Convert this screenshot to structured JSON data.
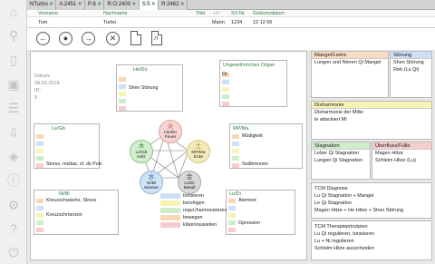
{
  "tabs": [
    {
      "label": "NTurbo",
      "active": false
    },
    {
      "label": "A:2451",
      "active": false
    },
    {
      "label": "P:6",
      "active": false
    },
    {
      "label": "R:O:2400",
      "active": false
    },
    {
      "label": "S:5",
      "active": true
    },
    {
      "label": "R:2462",
      "active": false
    }
  ],
  "tab_close": "×",
  "patient": {
    "headers": [
      "Vorname",
      "Nachname",
      "Titel",
      "♀/♂",
      "SV-Nr.",
      "Geburtsdatum"
    ],
    "row": [
      "Tom",
      "Turbo",
      "",
      "Mann",
      "1234",
      "12 12 66"
    ]
  },
  "info": {
    "datum_label": "Datum:",
    "datum": "28.03.2019",
    "id_label": "ID:",
    "id": "5"
  },
  "elements": {
    "fire": {
      "glyph": "火",
      "organs": "He/Dü",
      "name": "Feuer",
      "color": "#f5d5d5"
    },
    "earth": {
      "glyph": "土",
      "organs": "MP/Ma",
      "name": "Erde",
      "color": "#f3eabb"
    },
    "metal": {
      "glyph": "金",
      "organs": "Lu/Di",
      "name": "Metall",
      "color": "#d9d9d9"
    },
    "water": {
      "glyph": "水",
      "organs": "Ni/Bl",
      "name": "Wasser",
      "color": "#cfe3f5"
    },
    "wood": {
      "glyph": "木",
      "organs": "Le/Gb",
      "name": "Holz",
      "color": "#d3efcf"
    }
  },
  "organ_boxes": {
    "hedu": {
      "title": "He/Dü",
      "rows": [
        "",
        "Shen Störung",
        "",
        ""
      ]
    },
    "ungew": {
      "title": "Ungewöhnliches Organ",
      "rows": [
        "Or",
        "",
        "",
        ""
      ]
    },
    "legb": {
      "title": "Le/Gb",
      "rows": [
        "",
        "",
        "",
        "Stress, reizbar, sf, dü Puls"
      ]
    },
    "mpma": {
      "title": "MP/Ma",
      "rows": [
        "Müdigkeit",
        "",
        "",
        "Sodbrennen"
      ]
    },
    "nibl": {
      "title": "Ni/Bl",
      "rows": [
        "Kreuzschwäche, Stress",
        "",
        "Kreuzschmerzen",
        ""
      ]
    },
    "ludi": {
      "title": "Lu/Di",
      "rows": [
        "Atemnot",
        "",
        "",
        "Opression"
      ]
    }
  },
  "swatches": [
    "#f7d7b5",
    "#cde0f7",
    "#f7f3b5",
    "#cdeec9",
    "#f7cccc"
  ],
  "legend": [
    {
      "label": "tonisieren",
      "color": "#cde0f7"
    },
    {
      "label": "beruhigen",
      "color": "#f7f3b5"
    },
    {
      "label": "regul./harmonisieren",
      "color": "#cdeec9"
    },
    {
      "label": "bewegen",
      "color": "#f7d7b5"
    },
    {
      "label": "klären/ausleiten",
      "color": "#f7cccc"
    }
  ],
  "right": {
    "mangel": {
      "title": "Mangel/Leere",
      "text": "Lungen und Nieren Qi Mangel",
      "color": "#f8dcc0"
    },
    "stoerung": {
      "title": "Störung",
      "lines": [
        "Shen Störung",
        "Reb (Lu Qi)"
      ],
      "color": "#cde0f7"
    },
    "disharmonie": {
      "title": "Disharmonie",
      "lines": [
        "Disharmonie der Mitte",
        "le attackiert MI"
      ],
      "color": "#f7f3b5"
    },
    "stagnation": {
      "title": "Stagnation",
      "lines": [
        "Leber Qi Stagnation",
        "Lungen Qi Stagnation"
      ],
      "color": "#cdeec9"
    },
    "ueberfluss": {
      "title": "Überfluss/Fülle",
      "lines": [
        "Magen Hitze",
        "Schleim Hitze (Lu)"
      ],
      "color": "#f7cccc"
    },
    "diagnose": {
      "title": "TCM Diagnose",
      "lines": [
        "Lu Qi Stagnation + Mangel",
        "Le Qi Stagnation",
        "Magen Hitze + He Hitze + Shen Störung"
      ]
    },
    "therapie": {
      "title": "TCM Therapieprinzipien",
      "lines": [
        "Lu Qi regulieren, tonisieren",
        "Lu + Ni  regulieren",
        "Schleim Hitze ausscheiden"
      ]
    }
  }
}
